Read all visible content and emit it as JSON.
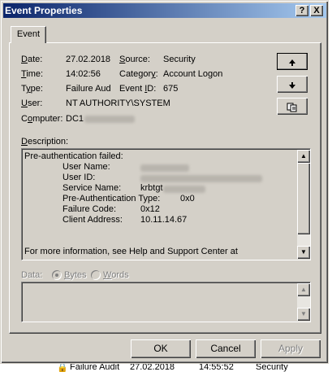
{
  "window": {
    "title": "Event Properties",
    "help_btn": "?",
    "close_btn": "X"
  },
  "tab": {
    "label": "Event"
  },
  "fields": {
    "date_label": "Date:",
    "date_value": "27.02.2018",
    "source_label": "Source:",
    "source_value": "Security",
    "time_label": "Time:",
    "time_value": "14:02:56",
    "category_label": "Category:",
    "category_value": "Account Logon",
    "type_label": "Type:",
    "type_value": "Failure Aud",
    "eventid_label": "Event ID:",
    "eventid_value": "675",
    "user_label": "User:",
    "user_value": "NT AUTHORITY\\SYSTEM",
    "computer_label": "Computer:",
    "computer_value": "DC1"
  },
  "nav": {
    "up_icon": "arrow-up-icon",
    "down_icon": "arrow-down-icon",
    "copy_icon": "copy-icon"
  },
  "description": {
    "label": "Description:",
    "line1": "Pre-authentication failed:",
    "user_name_label": "User Name:",
    "user_id_label": "User ID:",
    "service_name_label": "Service Name:",
    "service_name_value": "krbtgt",
    "preauth_type_label": "Pre-Authentication Type:",
    "preauth_type_value": "0x0",
    "failure_code_label": "Failure Code:",
    "failure_code_value": "0x12",
    "client_address_label": "Client Address:",
    "client_address_value": "10.11.14.67",
    "more_info": "For more information, see Help and Support Center at"
  },
  "data": {
    "label": "Data:",
    "bytes_label": "Bytes",
    "words_label": "Words"
  },
  "buttons": {
    "ok": "OK",
    "cancel": "Cancel",
    "apply": "Apply"
  },
  "background_row": {
    "type": "Failure Audit",
    "date": "27.02.2018",
    "time": "14:55:52",
    "source": "Security"
  }
}
